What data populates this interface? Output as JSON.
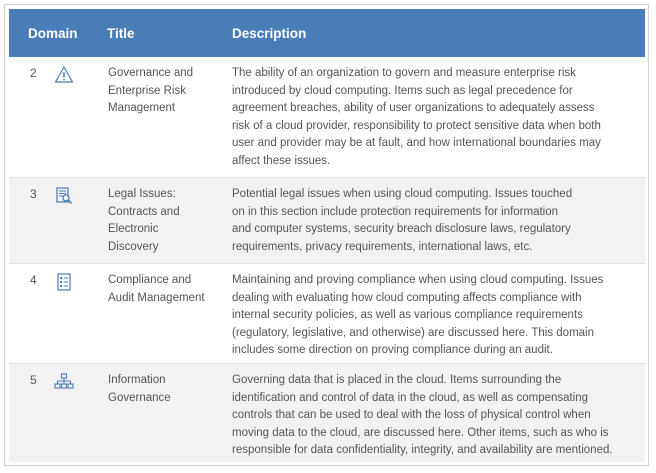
{
  "header": {
    "domain": "Domain",
    "title": "Title",
    "description": "Description"
  },
  "rows": [
    {
      "number": "2",
      "icon": "warning-triangle-icon",
      "title": "Governance and\nEnterprise Risk\nManagement",
      "description_lines": [
        "The ability of an organization to govern and measure enterprise risk",
        "introduced by cloud computing. Items such as legal precedence for",
        "agreement breaches, ability of user organizations to adequately assess",
        "risk of a cloud provider, responsibility to protect sensitive data when both",
        "user and provider may be at fault, and how international boundaries may",
        "affect these issues."
      ]
    },
    {
      "number": "3",
      "icon": "document-search-icon",
      "title": "Legal Issues:\nContracts and\nElectronic\nDiscovery",
      "description_lines": [
        "Potential legal issues when using cloud computing. Issues touched",
        "on in this section include protection requirements for information",
        "and computer systems, security breach disclosure laws, regulatory",
        "requirements, privacy requirements, international laws, etc."
      ]
    },
    {
      "number": "4",
      "icon": "checklist-icon",
      "title": "Compliance and\nAudit Management",
      "description_lines": [
        "Maintaining and proving compliance when using cloud computing. Issues",
        "dealing with evaluating how cloud computing affects compliance with",
        "internal security policies, as well as various compliance requirements",
        "(regulatory, legislative, and otherwise) are discussed here. This domain",
        "includes some direction on proving compliance during an audit."
      ]
    },
    {
      "number": "5",
      "icon": "org-chart-icon",
      "title": "Information\nGovernance",
      "description_lines": [
        "Governing data that is placed in the cloud. Items surrounding the",
        "identification and control of data in the cloud, as well as compensating",
        "controls that can be used to deal with the loss of physical control when",
        "moving data to the cloud, are discussed here. Other items, such as who is",
        "responsible for data confidentiality, integrity, and availability are mentioned."
      ]
    }
  ]
}
